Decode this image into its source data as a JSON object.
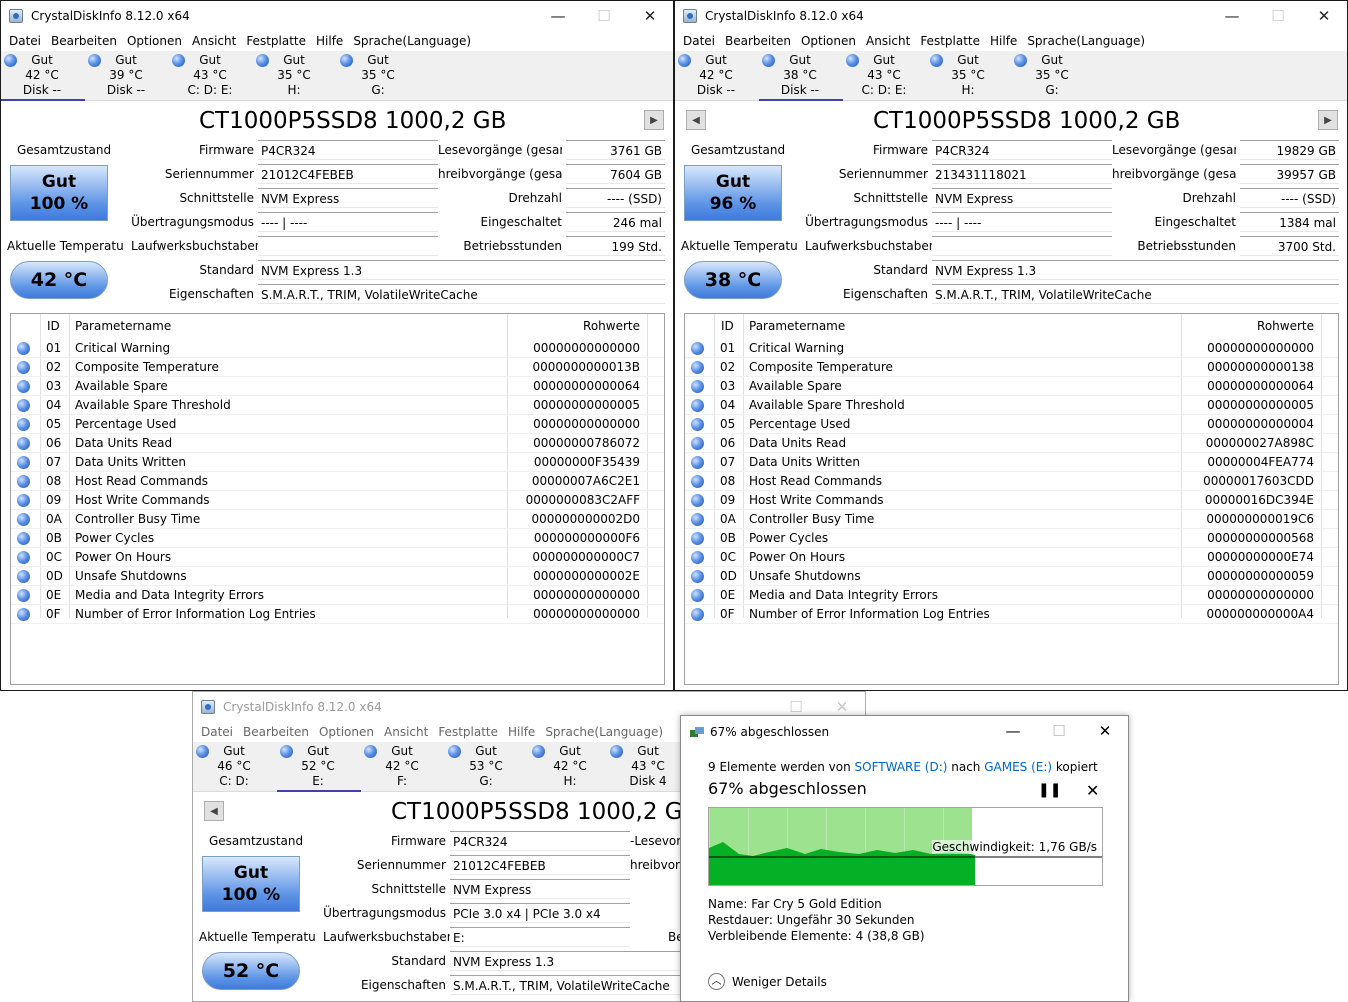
{
  "windows": [
    {
      "id": "w1",
      "title": "CrystalDiskInfo 8.12.0 x64",
      "menu": [
        "Datei",
        "Bearbeiten",
        "Optionen",
        "Ansicht",
        "Festplatte",
        "Hilfe",
        "Sprache(Language)"
      ],
      "disk_tabs": [
        {
          "status": "Gut",
          "temp": "42 °C",
          "name": "Disk --",
          "selected": true
        },
        {
          "status": "Gut",
          "temp": "39 °C",
          "name": "Disk --",
          "selected": false
        },
        {
          "status": "Gut",
          "temp": "43 °C",
          "name": "C: D: E:",
          "selected": false
        },
        {
          "status": "Gut",
          "temp": "35 °C",
          "name": "H:",
          "selected": false
        },
        {
          "status": "Gut",
          "temp": "35 °C",
          "name": "G:",
          "selected": false
        }
      ],
      "model": "CT1000P5SSD8 1000,2 GB",
      "health_label": "Gesamtzustand",
      "health_status": "Gut",
      "health_percent": "100 %",
      "temp_label": "Aktuelle Temperatu",
      "temperature": "42 °C",
      "fields": {
        "firmware_label": "Firmware",
        "firmware": "P4CR324",
        "serial_label": "Seriennummer",
        "serial": "21012C4FEBEB",
        "interface_label": "Schnittstelle",
        "interface": "NVM Express",
        "transfer_label": "Übertragungsmodus",
        "transfer": "---- | ----",
        "drive_letters_label": "Laufwerksbuchstaben",
        "drive_letters": "",
        "standard_label": "Standard",
        "standard": "NVM Express 1.3",
        "features_label": "Eigenschaften",
        "features": "S.M.A.R.T., TRIM, VolatileWriteCache",
        "reads_label": "Lesevorgänge (gesamt)",
        "reads": "3761 GB",
        "writes_label": "hreibvorgänge (gesamt)",
        "writes": "7604 GB",
        "rpm_label": "Drehzahl",
        "rpm": "---- (SSD)",
        "power_on_count_label": "Eingeschaltet",
        "power_on_count": "246 mal",
        "power_on_hours_label": "Betriebsstunden",
        "power_on_hours": "199 Std."
      },
      "smart_headers": {
        "id": "ID",
        "name": "Parametername",
        "raw": "Rohwerte"
      },
      "smart": [
        {
          "id": "01",
          "name": "Critical Warning",
          "raw": "00000000000000"
        },
        {
          "id": "02",
          "name": "Composite Temperature",
          "raw": "0000000000013B"
        },
        {
          "id": "03",
          "name": "Available Spare",
          "raw": "00000000000064"
        },
        {
          "id": "04",
          "name": "Available Spare Threshold",
          "raw": "00000000000005"
        },
        {
          "id": "05",
          "name": "Percentage Used",
          "raw": "00000000000000"
        },
        {
          "id": "06",
          "name": "Data Units Read",
          "raw": "00000000786072"
        },
        {
          "id": "07",
          "name": "Data Units Written",
          "raw": "00000000F35439"
        },
        {
          "id": "08",
          "name": "Host Read Commands",
          "raw": "00000007A6C2E1"
        },
        {
          "id": "09",
          "name": "Host Write Commands",
          "raw": "0000000083C2AFF"
        },
        {
          "id": "0A",
          "name": "Controller Busy Time",
          "raw": "000000000002D0"
        },
        {
          "id": "0B",
          "name": "Power Cycles",
          "raw": "000000000000F6"
        },
        {
          "id": "0C",
          "name": "Power On Hours",
          "raw": "000000000000C7"
        },
        {
          "id": "0D",
          "name": "Unsafe Shutdowns",
          "raw": "0000000000002E"
        },
        {
          "id": "0E",
          "name": "Media and Data Integrity Errors",
          "raw": "00000000000000"
        },
        {
          "id": "0F",
          "name": "Number of Error Information Log Entries",
          "raw": "00000000000000"
        }
      ]
    },
    {
      "id": "w2",
      "title": "CrystalDiskInfo 8.12.0 x64",
      "menu": [
        "Datei",
        "Bearbeiten",
        "Optionen",
        "Ansicht",
        "Festplatte",
        "Hilfe",
        "Sprache(Language)"
      ],
      "disk_tabs": [
        {
          "status": "Gut",
          "temp": "42 °C",
          "name": "Disk --",
          "selected": false
        },
        {
          "status": "Gut",
          "temp": "38 °C",
          "name": "Disk --",
          "selected": true
        },
        {
          "status": "Gut",
          "temp": "43 °C",
          "name": "C: D: E:",
          "selected": false
        },
        {
          "status": "Gut",
          "temp": "35 °C",
          "name": "H:",
          "selected": false
        },
        {
          "status": "Gut",
          "temp": "35 °C",
          "name": "G:",
          "selected": false
        }
      ],
      "model": "CT1000P5SSD8 1000,2 GB",
      "health_label": "Gesamtzustand",
      "health_status": "Gut",
      "health_percent": "96 %",
      "temp_label": "Aktuelle Temperatu",
      "temperature": "38 °C",
      "fields": {
        "firmware_label": "Firmware",
        "firmware": "P4CR324",
        "serial_label": "Seriennummer",
        "serial": "213431118021",
        "interface_label": "Schnittstelle",
        "interface": "NVM Express",
        "transfer_label": "Übertragungsmodus",
        "transfer": "---- | ----",
        "drive_letters_label": "Laufwerksbuchstaben",
        "drive_letters": "",
        "standard_label": "Standard",
        "standard": "NVM Express 1.3",
        "features_label": "Eigenschaften",
        "features": "S.M.A.R.T., TRIM, VolatileWriteCache",
        "reads_label": "Lesevorgänge (gesamt)",
        "reads": "19829 GB",
        "writes_label": "hreibvorgänge (gesamt)",
        "writes": "39957 GB",
        "rpm_label": "Drehzahl",
        "rpm": "---- (SSD)",
        "power_on_count_label": "Eingeschaltet",
        "power_on_count": "1384 mal",
        "power_on_hours_label": "Betriebsstunden",
        "power_on_hours": "3700 Std."
      },
      "smart_headers": {
        "id": "ID",
        "name": "Parametername",
        "raw": "Rohwerte"
      },
      "smart": [
        {
          "id": "01",
          "name": "Critical Warning",
          "raw": "00000000000000"
        },
        {
          "id": "02",
          "name": "Composite Temperature",
          "raw": "00000000000138"
        },
        {
          "id": "03",
          "name": "Available Spare",
          "raw": "00000000000064"
        },
        {
          "id": "04",
          "name": "Available Spare Threshold",
          "raw": "00000000000005"
        },
        {
          "id": "05",
          "name": "Percentage Used",
          "raw": "00000000000004"
        },
        {
          "id": "06",
          "name": "Data Units Read",
          "raw": "000000027A898C"
        },
        {
          "id": "07",
          "name": "Data Units Written",
          "raw": "00000004FEA774"
        },
        {
          "id": "08",
          "name": "Host Read Commands",
          "raw": "00000017603CDD"
        },
        {
          "id": "09",
          "name": "Host Write Commands",
          "raw": "00000016DC394E"
        },
        {
          "id": "0A",
          "name": "Controller Busy Time",
          "raw": "000000000019C6"
        },
        {
          "id": "0B",
          "name": "Power Cycles",
          "raw": "00000000000568"
        },
        {
          "id": "0C",
          "name": "Power On Hours",
          "raw": "00000000000E74"
        },
        {
          "id": "0D",
          "name": "Unsafe Shutdowns",
          "raw": "00000000000059"
        },
        {
          "id": "0E",
          "name": "Media and Data Integrity Errors",
          "raw": "00000000000000"
        },
        {
          "id": "0F",
          "name": "Number of Error Information Log Entries",
          "raw": "000000000000A4"
        }
      ]
    },
    {
      "id": "w3",
      "title": "CrystalDiskInfo 8.12.0 x64",
      "menu": [
        "Datei",
        "Bearbeiten",
        "Optionen",
        "Ansicht",
        "Festplatte",
        "Hilfe",
        "Sprache(Language)"
      ],
      "disk_tabs": [
        {
          "status": "Gut",
          "temp": "46 °C",
          "name": "C: D:",
          "selected": false
        },
        {
          "status": "Gut",
          "temp": "52 °C",
          "name": "E:",
          "selected": true
        },
        {
          "status": "Gut",
          "temp": "42 °C",
          "name": "F:",
          "selected": false
        },
        {
          "status": "Gut",
          "temp": "53 °C",
          "name": "G:",
          "selected": false
        },
        {
          "status": "Gut",
          "temp": "42 °C",
          "name": "H:",
          "selected": false
        },
        {
          "status": "Gut",
          "temp": "43 °C",
          "name": "Disk 4",
          "selected": false
        }
      ],
      "model": "CT1000P5SSD8 1000,2 GB",
      "health_label": "Gesamtzustand",
      "health_status": "Gut",
      "health_percent": "100 %",
      "temp_label": "Aktuelle Temperatu",
      "temperature": "52 °C",
      "fields": {
        "firmware_label": "Firmware",
        "firmware": "P4CR324",
        "serial_label": "Seriennummer",
        "serial": "21012C4FEBEB",
        "interface_label": "Schnittstelle",
        "interface": "NVM Express",
        "transfer_label": "Übertragungsmodus",
        "transfer": "PCIe 3.0 x4 | PCIe 3.0 x4",
        "drive_letters_label": "Laufwerksbuchstaben",
        "drive_letters": "E:",
        "standard_label": "Standard",
        "standard": "NVM Express 1.3",
        "features_label": "Eigenschaften",
        "features": "S.M.A.R.T., TRIM, VolatileWriteCache",
        "reads_label": "-Lesevorga",
        "writes_label": "hreibvorg",
        "extra_label": "Be"
      }
    }
  ],
  "copy_dialog": {
    "title": "67% abgeschlossen",
    "line_prefix": "9 Elemente werden von ",
    "source": "SOFTWARE (D:)",
    "line_mid": " nach ",
    "target": "GAMES (E:)",
    "line_suffix": " kopiert",
    "headline": "67% abgeschlossen",
    "progress_percent": 67,
    "speed": "Geschwindigkeit: 1,76 GB/s",
    "name_label": "Name:",
    "name": "Far Cry 5 Gold Edition",
    "remaining_label": "Restdauer:",
    "remaining": "Ungefähr 30 Sekunden",
    "items_label": "Verbleibende Elemente:",
    "items": "4 (38,8 GB)",
    "less_details": "Weniger Details",
    "pause_icon": "pause-icon",
    "cancel_icon": "close-icon",
    "graph_color": "#06b025",
    "graph_bg": "#9de28f"
  },
  "icons": {
    "minimize": "minimize-icon",
    "maximize": "maximize-icon",
    "close": "close-icon",
    "orb": "status-orb-icon",
    "prev": "prev-disk-icon",
    "next": "next-disk-icon"
  }
}
